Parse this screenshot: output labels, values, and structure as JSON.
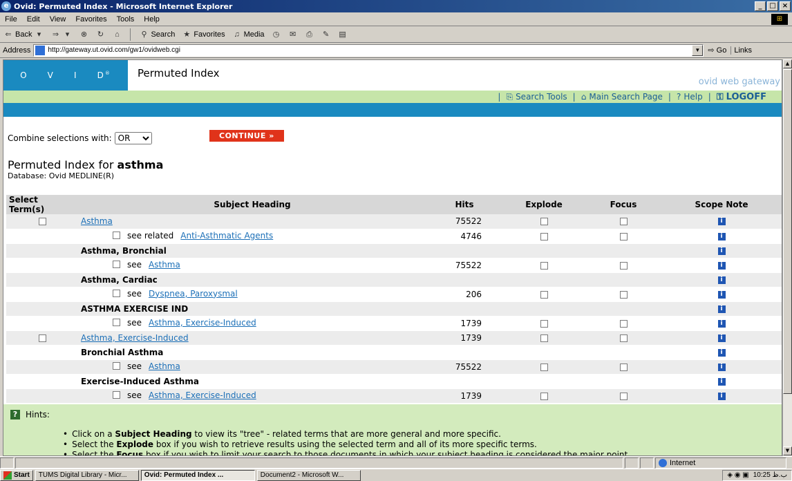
{
  "window": {
    "title": "Ovid: Permuted Index - Microsoft Internet Explorer",
    "min": "_",
    "max": "□",
    "close": "×"
  },
  "menu": [
    "File",
    "Edit",
    "View",
    "Favorites",
    "Tools",
    "Help"
  ],
  "toolbar": {
    "back": "Back",
    "search": "Search",
    "favorites": "Favorites",
    "media": "Media"
  },
  "address": {
    "label": "Address",
    "url": "http://gateway.ut.ovid.com/gw1/ovidweb.cgi",
    "go": "Go",
    "links": "Links"
  },
  "ovid": {
    "logo_letters": [
      "O",
      "V",
      "I",
      "D"
    ],
    "page_title": "Permuted Index",
    "gateway": "ovid web gateway",
    "nav": {
      "search_tools": "Search Tools",
      "main_search": "Main Search Page",
      "help": "Help",
      "logoff": "LOGOFF"
    }
  },
  "combine": {
    "label": "Combine selections with:",
    "value": "OR",
    "continue": "CONTINUE »"
  },
  "heading": {
    "prefix": "Permuted Index for",
    "term": "asthma",
    "database": "Database: Ovid MEDLINE(R)"
  },
  "table": {
    "headers": {
      "select": "Select Term(s)",
      "subject": "Subject Heading",
      "hits": "Hits",
      "explode": "Explode",
      "focus": "Focus",
      "scope": "Scope Note"
    },
    "rows": [
      {
        "sel": true,
        "text": "Asthma",
        "hits": "75522",
        "exp": true,
        "foc": true
      },
      {
        "seeprefix": "see related",
        "text": "Anti-Asthmatic Agents",
        "hits": "4746",
        "exp": true,
        "foc": true
      },
      {
        "head": "Asthma, Bronchial"
      },
      {
        "seeprefix": "see",
        "text": "Asthma",
        "hits": "75522",
        "exp": true,
        "foc": true
      },
      {
        "head": "Asthma, Cardiac"
      },
      {
        "seeprefix": "see",
        "text": "Dyspnea, Paroxysmal",
        "hits": "206",
        "exp": true,
        "foc": true
      },
      {
        "head": "ASTHMA EXERCISE IND"
      },
      {
        "seeprefix": "see",
        "text": "Asthma, Exercise-Induced",
        "hits": "1739",
        "exp": true,
        "foc": true
      },
      {
        "sel": true,
        "text": "Asthma, Exercise-Induced",
        "hits": "1739",
        "exp": true,
        "foc": true
      },
      {
        "head": "Bronchial Asthma"
      },
      {
        "seeprefix": "see",
        "text": "Asthma",
        "hits": "75522",
        "exp": true,
        "foc": true
      },
      {
        "head": "Exercise-Induced Asthma"
      },
      {
        "seeprefix": "see",
        "text": "Asthma, Exercise-Induced",
        "hits": "1739",
        "exp": true,
        "foc": true
      }
    ]
  },
  "hints": {
    "title": "Hints:",
    "items": [
      [
        "Click on a ",
        "Subject Heading",
        " to view its \"tree\" - related terms that are more general and more specific."
      ],
      [
        "Select the ",
        "Explode",
        " box if you wish to retrieve results using the selected term and all of its more specific terms."
      ],
      [
        "Select the ",
        "Focus",
        " box if you wish to limit your search to those documents in which your subject heading is considered the major point"
      ]
    ]
  },
  "status": {
    "zone": "Internet"
  },
  "taskbar": {
    "start": "Start",
    "items": [
      "TUMS Digital Library - Micr...",
      "Ovid: Permuted Index ...",
      "Document2 - Microsoft W..."
    ],
    "active_index": 1,
    "clock": "10:25 ب.ظ"
  },
  "colors": {
    "ovid_blue": "#1a8ac0",
    "nav_green": "#c6e5a9",
    "continue_red": "#e0331a",
    "link_blue": "#1b6fb7"
  },
  "icons": [
    "ie-icon",
    "back-arrow-icon",
    "forward-arrow-icon",
    "stop-icon",
    "refresh-icon",
    "home-icon",
    "search-icon",
    "favorites-icon",
    "media-icon",
    "history-icon",
    "mail-icon",
    "print-icon",
    "edit-icon",
    "discuss-icon",
    "page-icon",
    "go-icon",
    "search-tools-icon",
    "house-icon",
    "help-icon",
    "logoff-icon",
    "info-icon",
    "hint-icon",
    "globe-icon",
    "windows-logo-icon"
  ]
}
